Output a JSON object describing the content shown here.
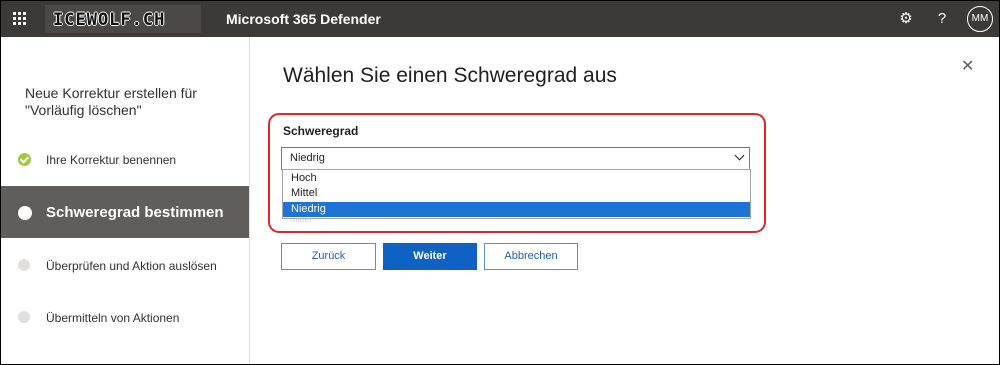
{
  "header": {
    "brand": "ICEWOLF.CH",
    "app_title": "Microsoft 365 Defender",
    "icons": [
      "waffle-icon",
      "gear-icon",
      "help-icon"
    ],
    "avatar_initials": "MM",
    "help_glyph": "?",
    "gear_glyph": "⚙"
  },
  "sidebar": {
    "title": "Neue Korrektur erstellen für \"Vorläufig löschen\"",
    "steps": [
      {
        "label": "Ihre Korrektur benennen",
        "state": "done"
      },
      {
        "label": "Schweregrad bestimmen",
        "state": "active"
      },
      {
        "label": "Überprüfen und Aktion auslösen",
        "state": "pending"
      },
      {
        "label": "Übermitteln von Aktionen",
        "state": "pending"
      }
    ]
  },
  "main": {
    "heading": "Wählen Sie einen Schweregrad aus",
    "close_glyph": "✕",
    "severity": {
      "label": "Schweregrad",
      "value": "Niedrig",
      "options": [
        "Hoch",
        "Mittel",
        "Niedrig"
      ],
      "selected_index": 2,
      "hidden_text": "Mittel"
    },
    "buttons": {
      "back": "Zurück",
      "next": "Weiter",
      "cancel": "Abbrechen"
    }
  },
  "colors": {
    "topbar": "#3b3a39",
    "active_step": "#605e5c",
    "done_check": "#a3c93a",
    "primary": "#0f62c4",
    "highlight": "#e0282b",
    "option_selected": "#1e73d6"
  }
}
